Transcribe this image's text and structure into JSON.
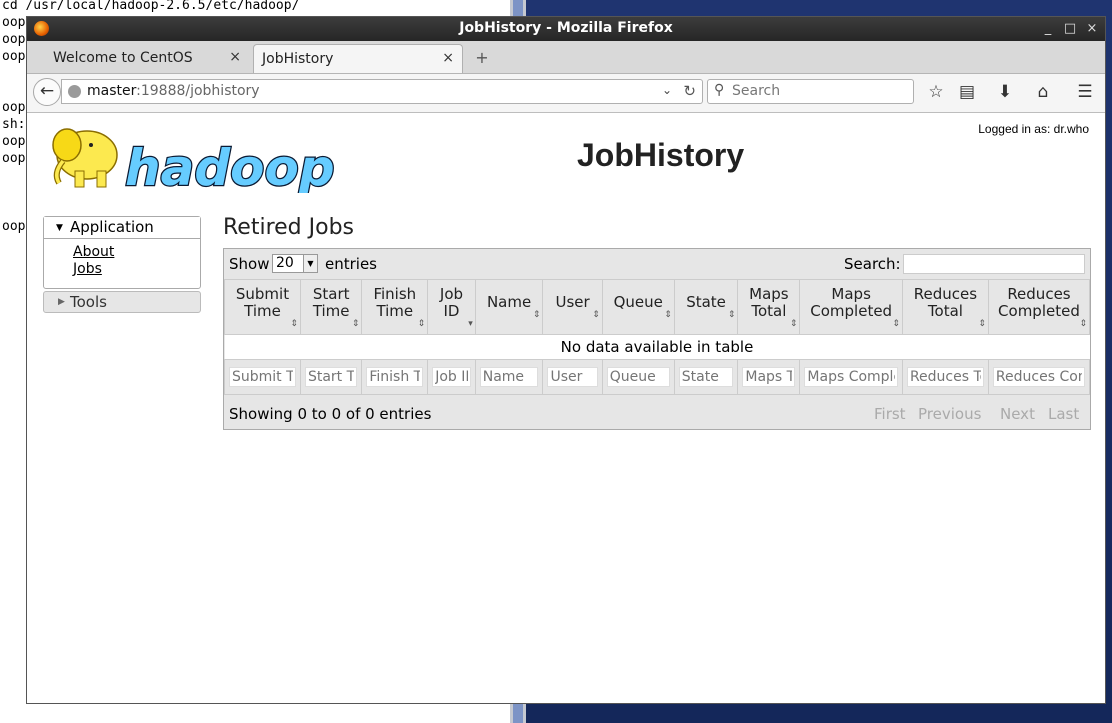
{
  "terminal": {
    "lines": [
      "cd /usr/local/hadoop-2.6.5/etc/hadoop/",
      "oop]",
      "oop]",
      "oop]",
      "",
      "",
      "oop]",
      "sh:",
      "oop]",
      "oop]",
      "",
      "",
      "",
      "oop]"
    ]
  },
  "window": {
    "title": "JobHistory - Mozilla Firefox",
    "min": "_",
    "max": "□",
    "close": "×"
  },
  "tabs": [
    {
      "label": "Welcome to CentOS",
      "active": false
    },
    {
      "label": "JobHistory",
      "active": true
    }
  ],
  "tab_close": "×",
  "new_tab": "+",
  "navbar": {
    "back": "←",
    "url_host": "master",
    "url_rest": ":19888/jobhistory",
    "url_dropdown": "⌄",
    "reload": "↻",
    "search_placeholder": "Search",
    "search_icon": "⚲",
    "bookmark_icon": "☆",
    "reading_icon": "▤",
    "download_icon": "⬇",
    "home_icon": "⌂",
    "menu_icon": "☰"
  },
  "header": {
    "logged_in": "Logged in as: dr.who",
    "title": "JobHistory",
    "logo_text": "hadoop"
  },
  "sidebar": {
    "application_label": "Application",
    "application_arrow": "▼",
    "links": [
      "About",
      "Jobs"
    ],
    "tools_label": "Tools",
    "tools_arrow": "▶"
  },
  "main": {
    "section_title": "Retired Jobs",
    "show_label": "Show",
    "show_value": "20",
    "show_dropdown": "▼",
    "entries_label": "entries",
    "search_label": "Search:",
    "columns": [
      {
        "label": "Submit Time",
        "sort": "⇕"
      },
      {
        "label": "Start Time",
        "sort": "⇕"
      },
      {
        "label": "Finish Time",
        "sort": "⇕"
      },
      {
        "label": "Job ID",
        "sort": "▾"
      },
      {
        "label": "Name",
        "sort": "⇕"
      },
      {
        "label": "User",
        "sort": "⇕"
      },
      {
        "label": "Queue",
        "sort": "⇕"
      },
      {
        "label": "State",
        "sort": "⇕"
      },
      {
        "label": "Maps Total",
        "sort": "⇕"
      },
      {
        "label": "Maps Completed",
        "sort": "⇕"
      },
      {
        "label": "Reduces Total",
        "sort": "⇕"
      },
      {
        "label": "Reduces Completed",
        "sort": "⇕"
      }
    ],
    "empty_message": "No data available in table",
    "filters": [
      "Submit T",
      "Start Ti",
      "Finish T",
      "Job ID",
      "Name",
      "User",
      "Queue",
      "State",
      "Maps To",
      "Maps Comple",
      "Reduces To",
      "Reduces Com"
    ],
    "info": "Showing 0 to 0 of 0 entries",
    "pagination": [
      "First",
      "Previous",
      "Next",
      "Last"
    ]
  }
}
